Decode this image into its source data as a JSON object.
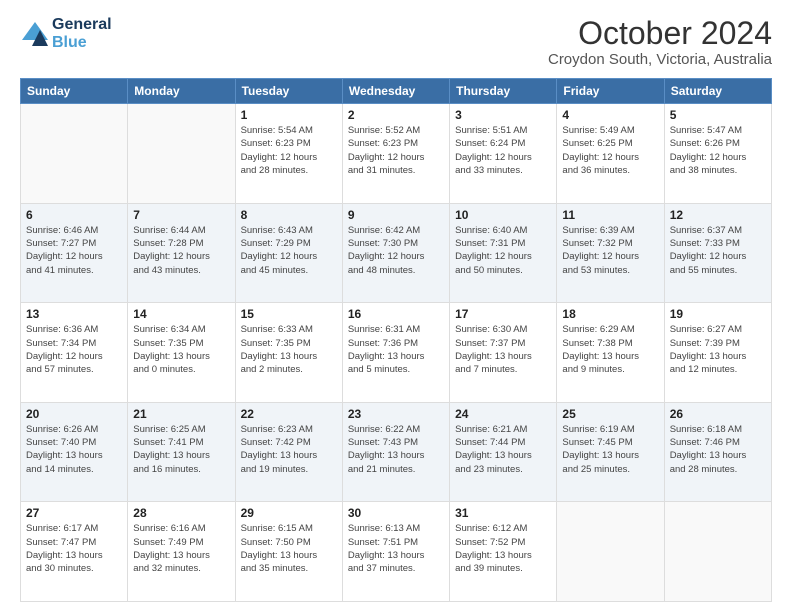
{
  "header": {
    "logo_line1": "General",
    "logo_line2": "Blue",
    "main_title": "October 2024",
    "subtitle": "Croydon South, Victoria, Australia"
  },
  "weekdays": [
    "Sunday",
    "Monday",
    "Tuesday",
    "Wednesday",
    "Thursday",
    "Friday",
    "Saturday"
  ],
  "weeks": [
    [
      {
        "day": "",
        "info": ""
      },
      {
        "day": "",
        "info": ""
      },
      {
        "day": "1",
        "info": "Sunrise: 5:54 AM\nSunset: 6:23 PM\nDaylight: 12 hours\nand 28 minutes."
      },
      {
        "day": "2",
        "info": "Sunrise: 5:52 AM\nSunset: 6:23 PM\nDaylight: 12 hours\nand 31 minutes."
      },
      {
        "day": "3",
        "info": "Sunrise: 5:51 AM\nSunset: 6:24 PM\nDaylight: 12 hours\nand 33 minutes."
      },
      {
        "day": "4",
        "info": "Sunrise: 5:49 AM\nSunset: 6:25 PM\nDaylight: 12 hours\nand 36 minutes."
      },
      {
        "day": "5",
        "info": "Sunrise: 5:47 AM\nSunset: 6:26 PM\nDaylight: 12 hours\nand 38 minutes."
      }
    ],
    [
      {
        "day": "6",
        "info": "Sunrise: 6:46 AM\nSunset: 7:27 PM\nDaylight: 12 hours\nand 41 minutes."
      },
      {
        "day": "7",
        "info": "Sunrise: 6:44 AM\nSunset: 7:28 PM\nDaylight: 12 hours\nand 43 minutes."
      },
      {
        "day": "8",
        "info": "Sunrise: 6:43 AM\nSunset: 7:29 PM\nDaylight: 12 hours\nand 45 minutes."
      },
      {
        "day": "9",
        "info": "Sunrise: 6:42 AM\nSunset: 7:30 PM\nDaylight: 12 hours\nand 48 minutes."
      },
      {
        "day": "10",
        "info": "Sunrise: 6:40 AM\nSunset: 7:31 PM\nDaylight: 12 hours\nand 50 minutes."
      },
      {
        "day": "11",
        "info": "Sunrise: 6:39 AM\nSunset: 7:32 PM\nDaylight: 12 hours\nand 53 minutes."
      },
      {
        "day": "12",
        "info": "Sunrise: 6:37 AM\nSunset: 7:33 PM\nDaylight: 12 hours\nand 55 minutes."
      }
    ],
    [
      {
        "day": "13",
        "info": "Sunrise: 6:36 AM\nSunset: 7:34 PM\nDaylight: 12 hours\nand 57 minutes."
      },
      {
        "day": "14",
        "info": "Sunrise: 6:34 AM\nSunset: 7:35 PM\nDaylight: 13 hours\nand 0 minutes."
      },
      {
        "day": "15",
        "info": "Sunrise: 6:33 AM\nSunset: 7:35 PM\nDaylight: 13 hours\nand 2 minutes."
      },
      {
        "day": "16",
        "info": "Sunrise: 6:31 AM\nSunset: 7:36 PM\nDaylight: 13 hours\nand 5 minutes."
      },
      {
        "day": "17",
        "info": "Sunrise: 6:30 AM\nSunset: 7:37 PM\nDaylight: 13 hours\nand 7 minutes."
      },
      {
        "day": "18",
        "info": "Sunrise: 6:29 AM\nSunset: 7:38 PM\nDaylight: 13 hours\nand 9 minutes."
      },
      {
        "day": "19",
        "info": "Sunrise: 6:27 AM\nSunset: 7:39 PM\nDaylight: 13 hours\nand 12 minutes."
      }
    ],
    [
      {
        "day": "20",
        "info": "Sunrise: 6:26 AM\nSunset: 7:40 PM\nDaylight: 13 hours\nand 14 minutes."
      },
      {
        "day": "21",
        "info": "Sunrise: 6:25 AM\nSunset: 7:41 PM\nDaylight: 13 hours\nand 16 minutes."
      },
      {
        "day": "22",
        "info": "Sunrise: 6:23 AM\nSunset: 7:42 PM\nDaylight: 13 hours\nand 19 minutes."
      },
      {
        "day": "23",
        "info": "Sunrise: 6:22 AM\nSunset: 7:43 PM\nDaylight: 13 hours\nand 21 minutes."
      },
      {
        "day": "24",
        "info": "Sunrise: 6:21 AM\nSunset: 7:44 PM\nDaylight: 13 hours\nand 23 minutes."
      },
      {
        "day": "25",
        "info": "Sunrise: 6:19 AM\nSunset: 7:45 PM\nDaylight: 13 hours\nand 25 minutes."
      },
      {
        "day": "26",
        "info": "Sunrise: 6:18 AM\nSunset: 7:46 PM\nDaylight: 13 hours\nand 28 minutes."
      }
    ],
    [
      {
        "day": "27",
        "info": "Sunrise: 6:17 AM\nSunset: 7:47 PM\nDaylight: 13 hours\nand 30 minutes."
      },
      {
        "day": "28",
        "info": "Sunrise: 6:16 AM\nSunset: 7:49 PM\nDaylight: 13 hours\nand 32 minutes."
      },
      {
        "day": "29",
        "info": "Sunrise: 6:15 AM\nSunset: 7:50 PM\nDaylight: 13 hours\nand 35 minutes."
      },
      {
        "day": "30",
        "info": "Sunrise: 6:13 AM\nSunset: 7:51 PM\nDaylight: 13 hours\nand 37 minutes."
      },
      {
        "day": "31",
        "info": "Sunrise: 6:12 AM\nSunset: 7:52 PM\nDaylight: 13 hours\nand 39 minutes."
      },
      {
        "day": "",
        "info": ""
      },
      {
        "day": "",
        "info": ""
      }
    ]
  ]
}
